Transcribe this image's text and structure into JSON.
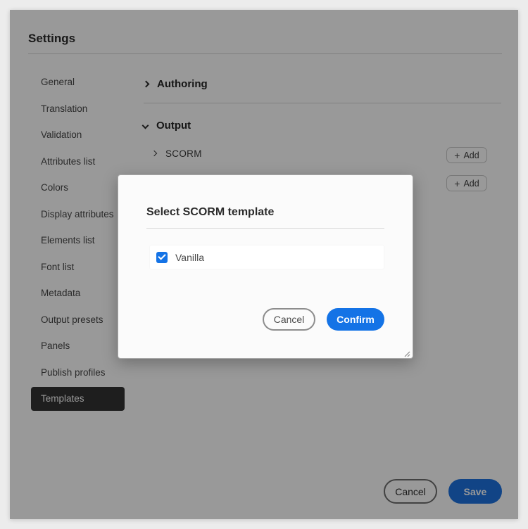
{
  "window": {
    "title": "Settings"
  },
  "sidebar": {
    "items": [
      {
        "label": "General",
        "selected": false
      },
      {
        "label": "Translation",
        "selected": false
      },
      {
        "label": "Validation",
        "selected": false
      },
      {
        "label": "Attributes list",
        "selected": false
      },
      {
        "label": "Colors",
        "selected": false
      },
      {
        "label": "Display attributes",
        "selected": false
      },
      {
        "label": "Elements list",
        "selected": false
      },
      {
        "label": "Font list",
        "selected": false
      },
      {
        "label": "Metadata",
        "selected": false
      },
      {
        "label": "Output presets",
        "selected": false
      },
      {
        "label": "Panels",
        "selected": false
      },
      {
        "label": "Publish profiles",
        "selected": false
      },
      {
        "label": "Templates",
        "selected": true
      }
    ]
  },
  "main": {
    "authoring": {
      "label": "Authoring",
      "expanded": false
    },
    "output": {
      "label": "Output",
      "expanded": true,
      "rows": [
        {
          "label": "SCORM",
          "expanded": false,
          "add_label": "Add"
        },
        {
          "add_label": "Add"
        }
      ]
    }
  },
  "modal": {
    "title": "Select SCORM template",
    "options": [
      {
        "label": "Vanilla",
        "checked": true
      }
    ],
    "cancel_label": "Cancel",
    "confirm_label": "Confirm"
  },
  "footer": {
    "cancel_label": "Cancel",
    "save_label": "Save"
  },
  "icons": {
    "plus": "+"
  },
  "colors": {
    "accent": "#1473e6",
    "selected_item_bg": "#323232",
    "overlay": "rgba(0,0,0,0.4)",
    "page_background": "#ececec"
  }
}
